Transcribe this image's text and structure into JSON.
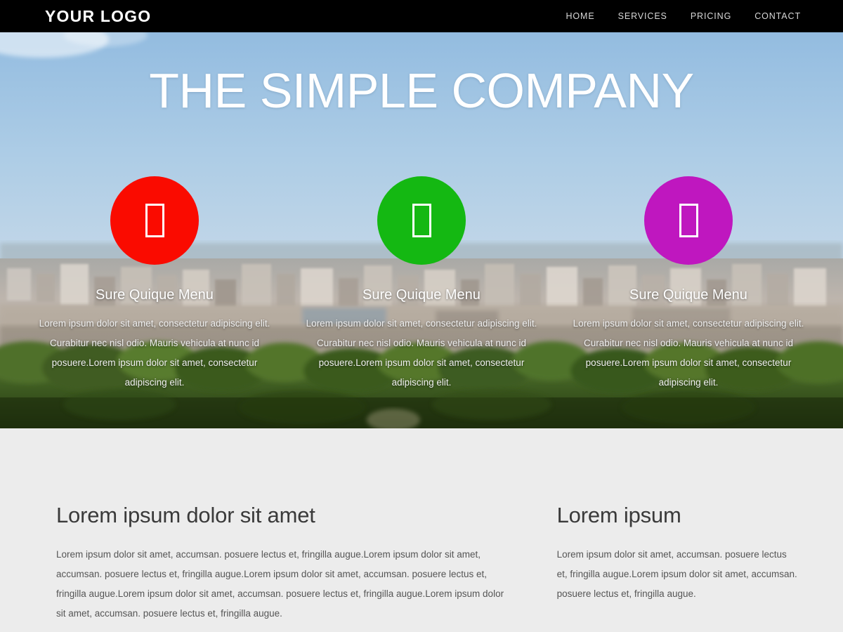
{
  "navbar": {
    "brand": "YOUR LOGO",
    "links": [
      {
        "label": "HOME"
      },
      {
        "label": "SERVICES"
      },
      {
        "label": "PRICING"
      },
      {
        "label": "CONTACT"
      }
    ]
  },
  "hero": {
    "title": "THE SIMPLE COMPANY",
    "background": {
      "sky_top": "#9cc2e3",
      "sky_bottom": "#b7d2e8",
      "city": "#b9b2ab",
      "foliage": "#3d5a22"
    },
    "cards": [
      {
        "icon": "missing-glyph-icon",
        "color": "#fa0b00",
        "title": "Sure Quique Menu",
        "body": "Lorem ipsum dolor sit amet, consectetur adipiscing elit. Curabitur nec nisl odio. Mauris vehicula at nunc id posuere.Lorem ipsum dolor sit amet, consectetur adipiscing elit."
      },
      {
        "icon": "missing-glyph-icon",
        "color": "#14b812",
        "title": "Sure Quique Menu",
        "body": "Lorem ipsum dolor sit amet, consectetur adipiscing elit. Curabitur nec nisl odio. Mauris vehicula at nunc id posuere.Lorem ipsum dolor sit amet, consectetur adipiscing elit."
      },
      {
        "icon": "missing-glyph-icon",
        "color": "#bf17bf",
        "title": "Sure Quique Menu",
        "body": "Lorem ipsum dolor sit amet, consectetur adipiscing elit. Curabitur nec nisl odio. Mauris vehicula at nunc id posuere.Lorem ipsum dolor sit amet, consectetur adipiscing elit."
      }
    ]
  },
  "content": {
    "background": "#ececec",
    "left": {
      "heading": "Lorem ipsum dolor sit amet",
      "text": "Lorem ipsum dolor sit amet, accumsan. posuere lectus et, fringilla augue.Lorem ipsum dolor sit amet, accumsan. posuere lectus et, fringilla augue.Lorem ipsum dolor sit amet, accumsan. posuere lectus et, fringilla augue.Lorem ipsum dolor sit amet, accumsan. posuere lectus et, fringilla augue.Lorem ipsum dolor sit amet, accumsan. posuere lectus et, fringilla augue."
    },
    "right": {
      "heading": "Lorem ipsum",
      "text": "Lorem ipsum dolor sit amet, accumsan. posuere lectus et, fringilla augue.Lorem ipsum dolor sit amet, accumsan. posuere lectus et, fringilla augue."
    }
  }
}
